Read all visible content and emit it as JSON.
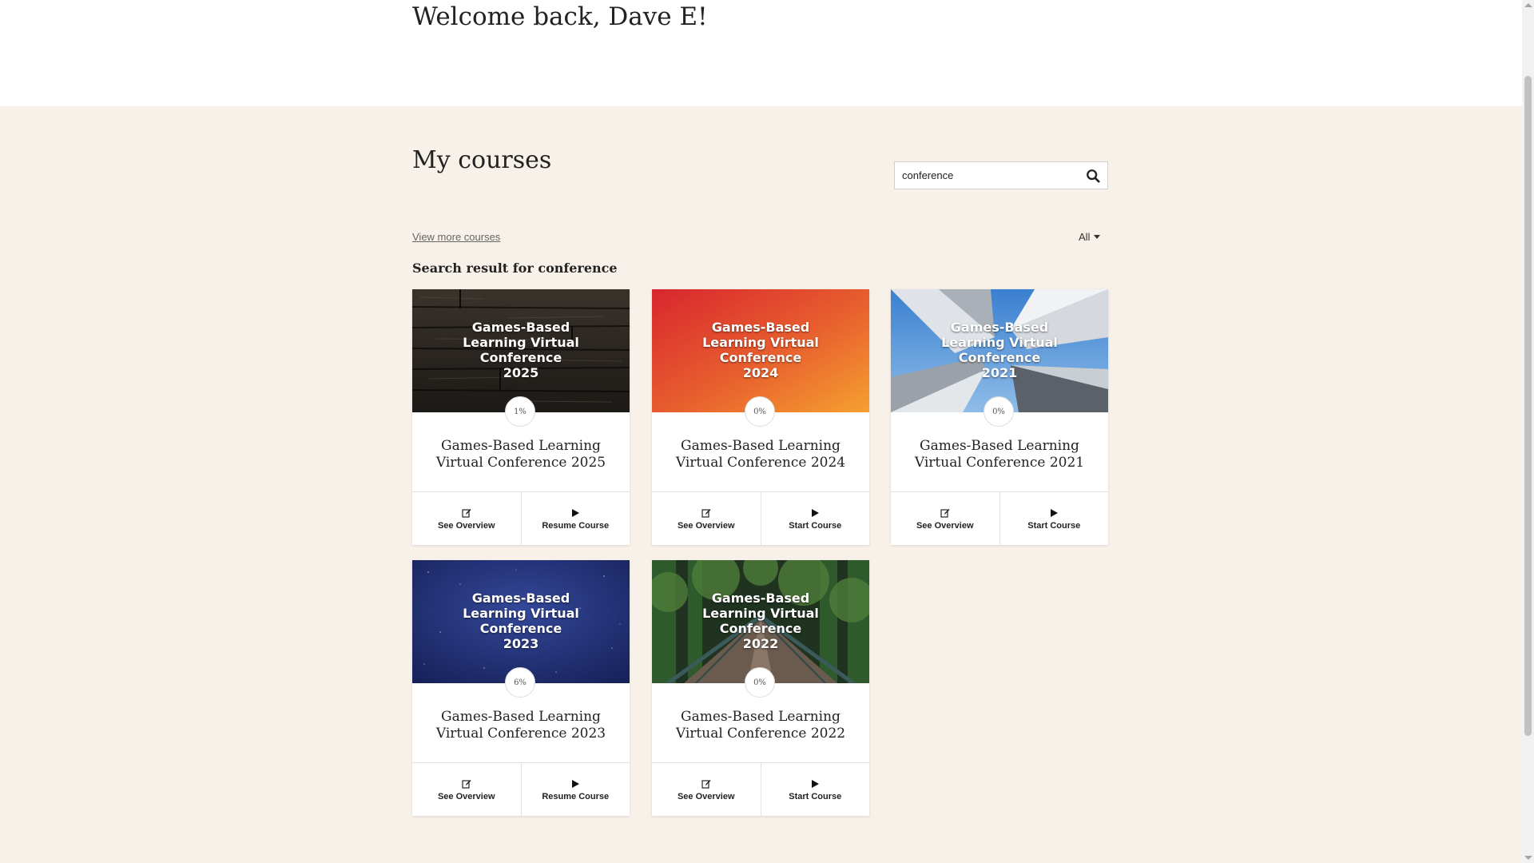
{
  "welcome": {
    "title": "Welcome back, Dave E!"
  },
  "courses": {
    "title": "My courses",
    "search": {
      "value": "conference",
      "placeholder": ""
    },
    "view_more_label": "View more courses",
    "filter_label": "All",
    "results_heading": "Search result for conference",
    "cards": [
      {
        "image_text": "Games-Based\nLearning Virtual\nConference\n2025",
        "progress": "1%",
        "title": "Games-Based Learning Virtual Conference 2025",
        "overview_label": "See Overview",
        "action_label": "Resume Course",
        "theme": "wood-dark"
      },
      {
        "image_text": "Games-Based\nLearning Virtual\nConference\n2024",
        "progress": "0%",
        "title": "Games-Based Learning Virtual Conference 2024",
        "overview_label": "See Overview",
        "action_label": "Start Course",
        "theme": "red-orange"
      },
      {
        "image_text": "Games-Based\nLearning Virtual\nConference\n2021",
        "progress": "0%",
        "title": "Games-Based Learning Virtual Conference 2021",
        "overview_label": "See Overview",
        "action_label": "Start Course",
        "theme": "sky-blue"
      },
      {
        "image_text": "Games-Based\nLearning Virtual\nConference\n2023",
        "progress": "6%",
        "title": "Games-Based Learning Virtual Conference 2023",
        "overview_label": "See Overview",
        "action_label": "Resume Course",
        "theme": "navy-starry"
      },
      {
        "image_text": "Games-Based\nLearning Virtual\nConference\n2022",
        "progress": "0%",
        "title": "Games-Based Learning Virtual Conference 2022",
        "overview_label": "See Overview",
        "action_label": "Start Course",
        "theme": "forest-bridge"
      }
    ]
  },
  "colors": {
    "section_bg": "#f7f1e9",
    "card_bg": "#ffffff",
    "text": "#222222"
  }
}
